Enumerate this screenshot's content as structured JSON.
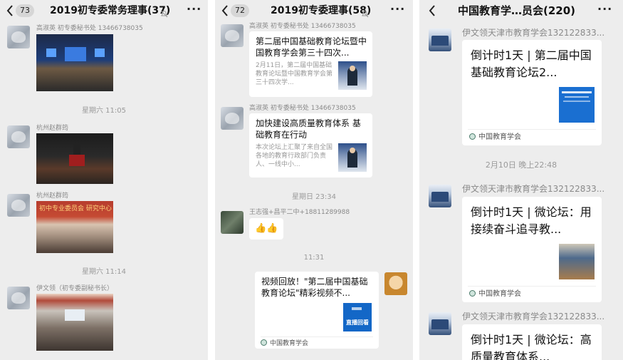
{
  "panel1": {
    "unread": "73",
    "title": "2019初专委常务理事(37)",
    "more": "···",
    "messages": [
      {
        "sender": "高淑英 初专委秘书处 13466738035"
      },
      {
        "time": "星期六 11:05"
      },
      {
        "sender": "杭州赵群筠"
      },
      {
        "sender": "杭州赵群筠",
        "banner": "初中专业委员会 研究中心"
      },
      {
        "time": "星期六 11:14"
      },
      {
        "sender": "伊文领（初专委副秘书长）"
      }
    ]
  },
  "panel2": {
    "unread": "72",
    "title": "2019初专委理事(58)",
    "more": "···",
    "messages": [
      {
        "sender": "高淑英 初专委秘书处 13466738035",
        "card_title": "第二届中国基础教育论坛暨中国教育学会第三十四次...",
        "card_desc": "2月11日，第二届中国基础教育论坛暨中国教育学会第三十四次学..."
      },
      {
        "sender": "高淑英 初专委秘书处 13466738035",
        "card_title": "加快建设高质量教育体系 基础教育在行动",
        "card_desc": "本次论坛上汇聚了来自全国各地的教育行政部门负责人、一线中小..."
      },
      {
        "time": "星期日 23:34"
      },
      {
        "sender": "王志强+昌平二中+18811289988",
        "emoji": "👍👍"
      },
      {
        "time": "11:31"
      },
      {
        "card_title": "视频回放！\"第二届中国基础教育论坛\"精彩视频不...",
        "thumb_label": "直播回看",
        "source": "中国教育学会"
      }
    ]
  },
  "panel3": {
    "title": "中国教育学…员会(220)",
    "more": "···",
    "messages": [
      {
        "sender": "伊文领天津市教育学会132122833...",
        "card_title": "倒计时1天 | 第二届中国基础教育论坛2...",
        "source": "中国教育学会"
      },
      {
        "time": "2月10日 晚上22:48"
      },
      {
        "sender": "伊文领天津市教育学会132122833...",
        "card_title": "倒计时1天 | 微论坛：用接续奋斗追寻教...",
        "source": "中国教育学会"
      },
      {
        "sender": "伊文领天津市教育学会132122833...",
        "card_title": "倒计时1天 | 微论坛：高质量教育体系..."
      }
    ]
  }
}
